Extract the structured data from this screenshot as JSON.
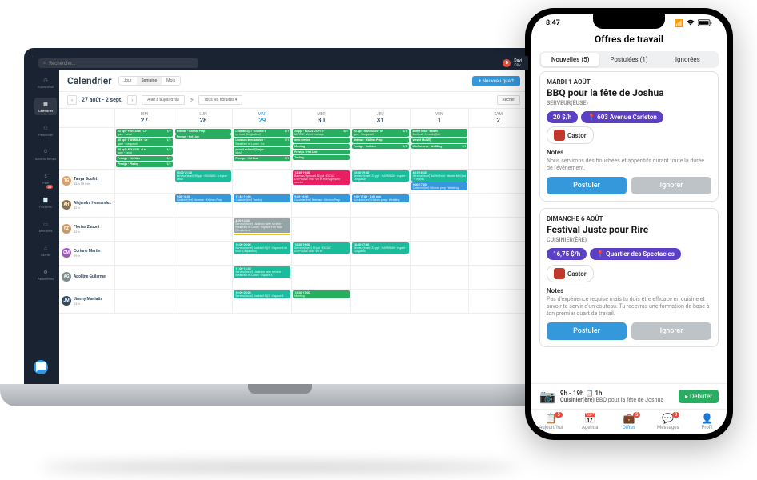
{
  "laptop": {
    "search_placeholder": "Recherche...",
    "user": {
      "initial": "D",
      "name": "Davi",
      "name2": "Oliv"
    },
    "sidebar": [
      {
        "label": "Aujourd'hui",
        "icon": "clock"
      },
      {
        "label": "Calendrier",
        "icon": "calendar",
        "active": true
      },
      {
        "label": "Personnel",
        "icon": "people"
      },
      {
        "label": "Suivi du temps",
        "icon": "timer"
      },
      {
        "label": "Paie",
        "icon": "money"
      },
      {
        "label": "Factures",
        "icon": "invoice",
        "badge": "20"
      },
      {
        "label": "Membres",
        "icon": "card"
      },
      {
        "label": "Clients",
        "icon": "store"
      },
      {
        "label": "Paramètres",
        "icon": "gear"
      }
    ],
    "page_title": "Calendrier",
    "view_tabs": [
      "Jour",
      "Semaine",
      "Mois"
    ],
    "active_view": "Semaine",
    "new_shift_btn": "+ Nouveau quart",
    "date_range": "27 août - 2 sept.",
    "today_btn": "Aller à aujourd'hui",
    "schedules_btn": "Tous les horaires",
    "search_btn": "Recher",
    "days": [
      {
        "dow": "DIM",
        "dom": "27"
      },
      {
        "dow": "LUN",
        "dom": "28"
      },
      {
        "dow": "MAR",
        "dom": "29",
        "today": true
      },
      {
        "dow": "MER",
        "dom": "30"
      },
      {
        "dow": "JEU",
        "dom": "31"
      },
      {
        "dow": "VEN",
        "dom": "1"
      },
      {
        "dow": "SAM",
        "dom": "2"
      }
    ],
    "open_shifts_row": {
      "cells": [
        [
          {
            "cls": "ev-green",
            "t": "25 ppl - FONTAINE - Le-",
            "d": "gare - Laval",
            "suffix": "1/1"
          },
          {
            "cls": "ev-green",
            "t": "50 ppl - TREMBLAY - Le-",
            "d": "gare - Longueuil",
            "suffix": "1/1"
          },
          {
            "cls": "ev-green",
            "t": "50 ppl - ROUSSEL - Le-",
            "d": "gare - Laval",
            "suffix": "1/1"
          },
          {
            "cls": "ev-green",
            "t": "Provigo - Hot Line",
            "d": "",
            "suffix": "1/1"
          },
          {
            "cls": "ev-green",
            "t": "Provigo - Plating",
            "d": "",
            "suffix": "1/1"
          }
        ],
        [
          {
            "cls": "ev-green",
            "t": "Notman - Kitchen Prep",
            "d": "",
            "suffix": ""
          },
          {
            "cls": "ev-green",
            "t": "Provigo - Hot Line",
            "d": "",
            "suffix": ""
          }
        ],
        [
          {
            "cls": "ev-green",
            "t": "Cocktail 5@7 - Espace 4",
            "d": "en haut (Desjardins)",
            "suffix": "0/1"
          },
          {
            "cls": "ev-green",
            "t": "Livraison avec service -",
            "d": "Breakfast et Lunch - Es-",
            "suffix": "1/1"
          },
          {
            "cls": "ev-green",
            "t": "pace 4 en haut (Desjar-",
            "d": "dins)",
            "suffix": ""
          },
          {
            "cls": "ev-green",
            "t": "Provigo - Hot Line",
            "d": "",
            "suffix": "1/1"
          }
        ],
        [
          {
            "cls": "ev-green",
            "t": "50 ppl - ÉCOLE D'OPTO-",
            "d": "MÉTRIE- Vin et fromage",
            "suffix": "0/1"
          },
          {
            "cls": "ev-green",
            "t": "avec service",
            "d": "",
            "suffix": ""
          },
          {
            "cls": "ev-green",
            "t": "Meeting",
            "d": "",
            "suffix": ""
          },
          {
            "cls": "ev-green",
            "t": "Provigo - Hot Line",
            "d": "",
            "suffix": ""
          },
          {
            "cls": "ev-green",
            "t": "Tasting",
            "d": "",
            "suffix": ""
          }
        ],
        [
          {
            "cls": "ev-green",
            "t": "25 ppl - HARRISON - le-",
            "d": "gare - Longueuil",
            "suffix": "0/1"
          },
          {
            "cls": "ev-green",
            "t": "Notman - Kitchen Prep",
            "d": "",
            "suffix": ""
          },
          {
            "cls": "ev-green",
            "t": "Provigo - Hot Line",
            "d": "",
            "suffix": "1/1"
          }
        ],
        [
          {
            "cls": "ev-green",
            "t": "Buffet froid - Musée",
            "d": "McCord - 5 molds (Uni-",
            "suffix": ""
          },
          {
            "cls": "ev-green",
            "t": "versité McGill)",
            "d": "",
            "suffix": ""
          },
          {
            "cls": "ev-green",
            "t": "Kitchen prep - Wedding",
            "d": "",
            "suffix": "1/1"
          }
        ],
        []
      ]
    },
    "people": [
      {
        "name": "Tanya Goulet",
        "hours": "43 h 15 min",
        "initial": "TG",
        "color": "#d4a574",
        "cells": [
          [
            {
              "cls": "ev-cyan",
              "t": "15:00-21:30",
              "d": "Serveur(euse) 50 ppl - ROUSSEL - Legare - Laval"
            }
          ],
          [],
          [
            {
              "cls": "ev-pink",
              "t": "13:30-19:00",
              "d": "Barman/Barmaid 50 ppl - ÉCOLE D'OPTOMÉTRIE- Vin et fromage avec service"
            }
          ],
          [
            {
              "cls": "ev-cyan",
              "t": "10:00-19:00",
              "d": "Serveur(euse) 25 ppl - HARRISON - legare - Longueuil"
            }
          ],
          [
            {
              "cls": "ev-cyan",
              "t": "8:15-16:30",
              "d": "Serveur(euse) Buffet froid - Musée McCord - 9 molds"
            },
            {
              "cls": "ev-blue",
              "t": "9:00-17:00",
              "d": "Cuisinier(ère) Kitchen prep - Wedding"
            }
          ],
          []
        ]
      },
      {
        "name": "Alejandra Hernandez",
        "hours": "32 h",
        "initial": "AH",
        "color": "#8b6f47",
        "cells": [
          [
            {
              "cls": "ev-blue",
              "t": "9:00-16:00",
              "d": "Cuisinier(ère) Notman - Kitchen Prep"
            }
          ],
          [
            {
              "cls": "ev-blue",
              "t": "17:45-19:00",
              "d": "Cuisinier(ère) Tasting"
            }
          ],
          [
            {
              "cls": "ev-blue",
              "t": "9:00-16:00",
              "d": "Cuisinier(ère) Notman - Kitchen Prep"
            }
          ],
          [
            {
              "cls": "ev-blue",
              "t": "9:00-17:00 - 5:00 min",
              "d": "Cuisinier(ère) Kitchen prep - Wedding"
            }
          ],
          [],
          []
        ]
      },
      {
        "name": "Florian Zanoni",
        "hours": "32 h",
        "initial": "FZ",
        "color": "#c49a6c",
        "cells": [
          [],
          [
            {
              "cls": "ev-gray",
              "t": "4:00-13:30",
              "d": "Serveur(euse) Livraison avec service - Breakfast et Lunch - Espace 4 en haut (Desjardins)"
            },
            {
              "cls": "ev-yellow",
              "t": "",
              "d": ""
            }
          ],
          [],
          [],
          [],
          []
        ]
      },
      {
        "name": "Corinne Martin",
        "hours": "29 h",
        "initial": "CM",
        "color": "#9b59b6",
        "cells": [
          [],
          [
            {
              "cls": "ev-cyan",
              "t": "16:00-20:00",
              "d": "Serveur(euse) Cocktail 5@7 - Espace 4 en haut (Desjardins)"
            }
          ],
          [
            {
              "cls": "ev-cyan",
              "t": "13:30-19:00",
              "d": "Serveur(euse) 50 ppl - ÉCOLE D'OPTOMÉTRIE- Vin et"
            }
          ],
          [
            {
              "cls": "ev-cyan",
              "t": "10:00-17:00",
              "d": "Serveur(euse) 25 ppl - HARRISON - legare - Longueuil"
            }
          ],
          [],
          []
        ]
      },
      {
        "name": "Apolline Guilarme",
        "hours": "",
        "initial": "AG",
        "color": "#7f8c8d",
        "cells": [
          [],
          [
            {
              "cls": "ev-cyan",
              "t": "11:00-13:30",
              "d": "Serveur(euse) Livraison avec service - Breakfast et Lunch - Espace 4"
            }
          ],
          [],
          [],
          [],
          []
        ]
      },
      {
        "name": "Jimmy Maniatis",
        "hours": "23 h",
        "initial": "JM",
        "color": "#34495e",
        "cells": [
          [],
          [
            {
              "cls": "ev-cyan",
              "t": "16:00-20:00",
              "d": "Serveur(euse) Cocktail 5@7 - Espace 4"
            }
          ],
          [
            {
              "cls": "ev-green",
              "t": "13:30-17:00",
              "d": "Meeting"
            }
          ],
          [],
          [],
          []
        ]
      }
    ]
  },
  "phone": {
    "time": "8:47",
    "title": "Offres de travail",
    "segments": [
      "Nouvelles (5)",
      "Postulées (1)",
      "Ignorées"
    ],
    "active_segment": 0,
    "offers": [
      {
        "date": "MARDI 1 AOÛT",
        "title": "BBQ pour la fête de Joshua",
        "role": "SERVEUR(EUSE)",
        "rate": "20 $/h",
        "location": "603 Avenue Carleton",
        "client": "Castor",
        "notes_label": "Notes",
        "notes": "Nous servirons des bouchées et appéritifs durant toute la durée de l'événement.",
        "apply": "Postuler",
        "ignore": "Ignorer"
      },
      {
        "date": "DIMANCHE 6 AOÛT",
        "title": "Festival Juste pour Rire",
        "role": "CUISINIER(ÈRE)",
        "rate": "16,75 $/h",
        "location": "Quartier des Spectacles",
        "client": "Castor",
        "notes_label": "Notes",
        "notes": "Pas d'expérience requise mais tu dois être efficace en cuisine et savoir te servir d'un couteau. Tu recevras une formation de base à ton premier quart de travail.",
        "apply": "Postuler",
        "ignore": "Ignorer"
      }
    ],
    "bottom_card": {
      "time": "9h - 19h",
      "duration": "1h",
      "role": "Cuisinier(ère)",
      "event": "BBQ pour la fête de Joshua",
      "start_btn": "Débuter"
    },
    "tabs": [
      {
        "label": "Aujourd'hui",
        "badge": "5"
      },
      {
        "label": "Agenda"
      },
      {
        "label": "Offres",
        "badge": "5",
        "active": true
      },
      {
        "label": "Messages",
        "badge": "3"
      },
      {
        "label": "Profil"
      }
    ]
  }
}
